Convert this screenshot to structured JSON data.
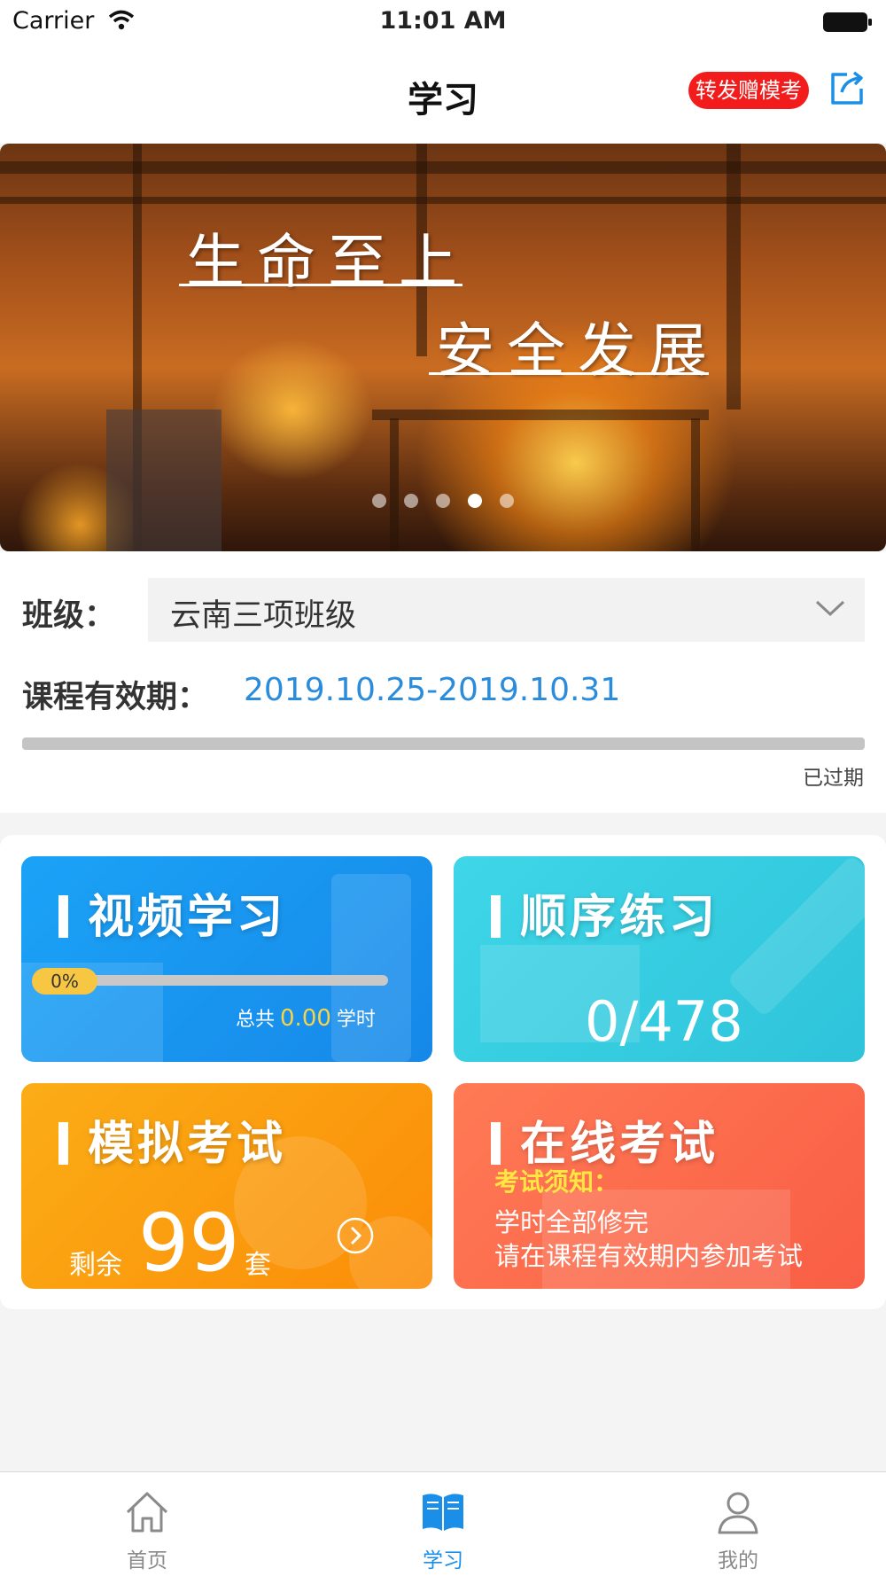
{
  "status_bar": {
    "carrier": "Carrier",
    "time": "11:01 AM"
  },
  "nav": {
    "title": "学习",
    "share_badge": "转发赠模考",
    "share_icon": "share-icon"
  },
  "banner": {
    "line1": "生命至上",
    "line2": "安全发展",
    "slide_count": 5,
    "active_slide": 4
  },
  "class_info": {
    "class_label": "班级：",
    "class_value": "云南三项班级",
    "period_label": "课程有效期：",
    "period_value": "2019.10.25-2019.10.31",
    "status": "已过期"
  },
  "cards": {
    "video": {
      "title": "视频学习",
      "progress": "0%",
      "progress_fraction": 0,
      "total_prefix": "总共",
      "total_value": "0.00",
      "total_unit": "学时"
    },
    "sequence": {
      "title": "顺序练习",
      "count": "0/478"
    },
    "mock": {
      "title": "模拟考试",
      "remain_label": "剩余",
      "remain_value": "99",
      "remain_unit": "套"
    },
    "online": {
      "title": "在线考试",
      "notice_title": "考试须知：",
      "notice_line1": "学时全部修完",
      "notice_line2": "请在课程有效期内参加考试"
    }
  },
  "tabs": [
    {
      "label": "首页",
      "icon": "home-icon",
      "active": false
    },
    {
      "label": "学习",
      "icon": "book-icon",
      "active": true
    },
    {
      "label": "我的",
      "icon": "user-icon",
      "active": false
    }
  ],
  "colors": {
    "accent": "#1b8fe8",
    "badge": "#f21c1c",
    "period": "#2a8cdb"
  }
}
